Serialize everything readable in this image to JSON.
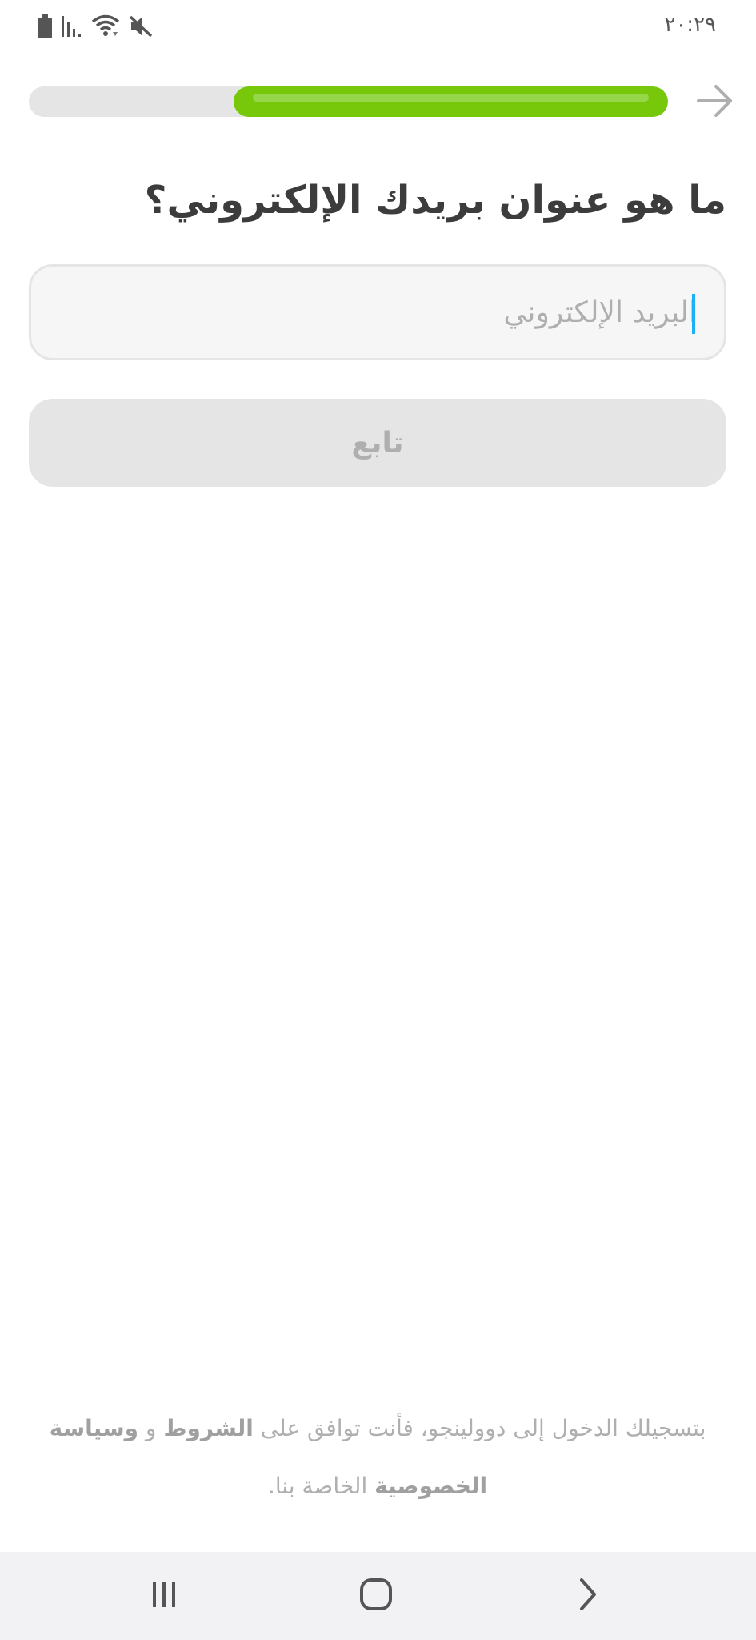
{
  "status_bar": {
    "time": "٢٠:٢٩",
    "icons": [
      "battery-icon",
      "signal-icon",
      "wifi-icon",
      "mute-icon"
    ]
  },
  "progress": {
    "fraction": 0.68,
    "color": "#77c70a",
    "track_color": "#e5e5e5"
  },
  "header": {
    "back_icon": "arrow-right-icon"
  },
  "main": {
    "title": "ما هو عنوان بريدك الإلكتروني؟",
    "email_placeholder": "البريد الإلكتروني",
    "email_value": "",
    "continue_label": "تابع"
  },
  "legal": {
    "prefix": "بتسجيلك الدخول إلى دوولينجو، فأنت توافق على",
    "terms_label": "الشروط",
    "conjunction": "و",
    "privacy_label": "وسياسة الخصوصية",
    "suffix": "الخاصة بنا."
  },
  "nav_bar": {
    "icons": [
      "recent-apps-icon",
      "home-icon",
      "back-icon"
    ]
  },
  "colors": {
    "accent_green": "#77c70a",
    "cursor_blue": "#1cb0f6",
    "title_text": "#3c3c3c",
    "muted_text": "#afafaf"
  }
}
